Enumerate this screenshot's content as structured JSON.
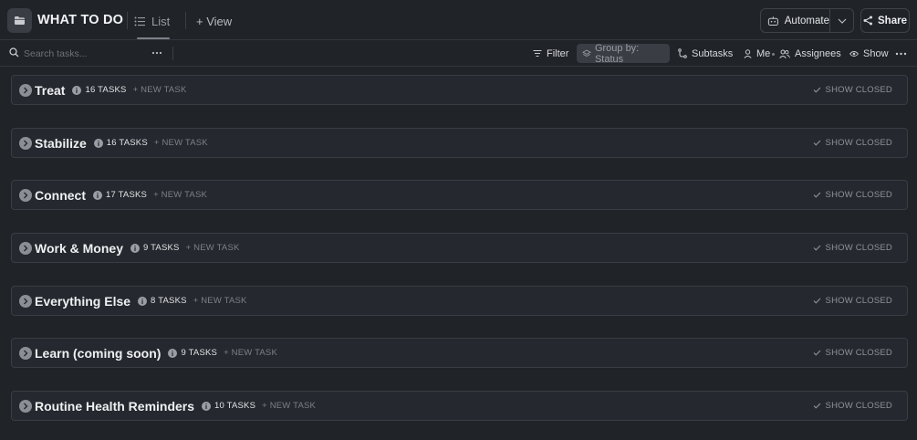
{
  "header": {
    "title": "WHAT TO DO",
    "tab_list_label": "List",
    "add_view_label": "+ View",
    "automate_label": "Automate",
    "share_label": "Share"
  },
  "toolbar": {
    "search_placeholder": "Search tasks...",
    "filter_label": "Filter",
    "group_by_label": "Group by: Status",
    "subtasks_label": "Subtasks",
    "me_label": "Me",
    "assignees_label": "Assignees",
    "show_label": "Show"
  },
  "groups": [
    {
      "name": "Treat",
      "count": "16 TASKS",
      "new_task": "+ NEW TASK",
      "show_closed": "SHOW CLOSED"
    },
    {
      "name": "Stabilize",
      "count": "16 TASKS",
      "new_task": "+ NEW TASK",
      "show_closed": "SHOW CLOSED"
    },
    {
      "name": "Connect",
      "count": "17 TASKS",
      "new_task": "+ NEW TASK",
      "show_closed": "SHOW CLOSED"
    },
    {
      "name": "Work & Money",
      "count": "9 TASKS",
      "new_task": "+ NEW TASK",
      "show_closed": "SHOW CLOSED"
    },
    {
      "name": "Everything Else",
      "count": "8 TASKS",
      "new_task": "+ NEW TASK",
      "show_closed": "SHOW CLOSED"
    },
    {
      "name": "Learn (coming soon)",
      "count": "9 TASKS",
      "new_task": "+ NEW TASK",
      "show_closed": "SHOW CLOSED"
    },
    {
      "name": "Routine Health Reminders",
      "count": "10 TASKS",
      "new_task": "+ NEW TASK",
      "show_closed": "SHOW CLOSED"
    }
  ],
  "icons": {
    "folder": "folder-icon",
    "list": "list-icon",
    "search": "search-icon",
    "filter": "filter-icon",
    "group_by": "layers-icon",
    "subtasks": "subtasks-icon",
    "me": "user-icon",
    "assignees": "users-icon",
    "show": "eye-icon",
    "automate": "robot-icon",
    "share": "share-icon"
  },
  "colors": {
    "background": "#202328",
    "group_background": "#25282e",
    "border": "#3a3d44"
  }
}
